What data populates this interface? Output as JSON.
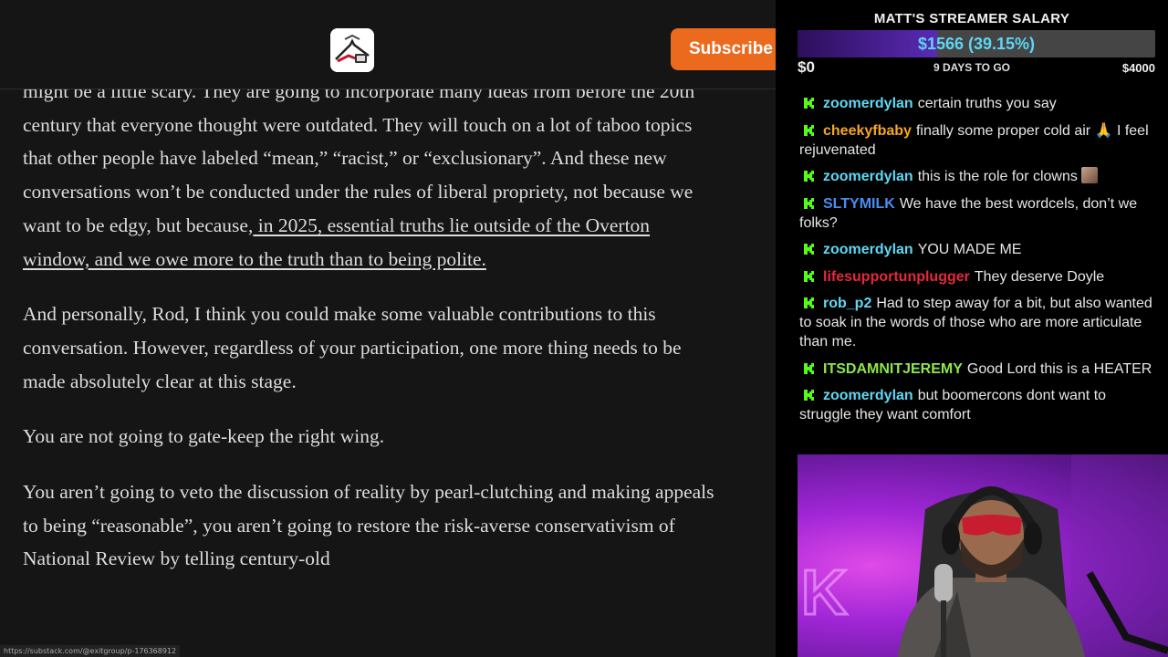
{
  "article": {
    "subscribe_label": "Subscribe",
    "paragraphs": {
      "p1": "might be a little scary. They are going to incorporate many ideas from before the 20th century that everyone thought were outdated. They will touch on a lot of taboo topics that other people have labeled “mean,” “racist,” or “exclusionary”. And these new conversations won’t be conducted under the rules of liberal propriety, not because we want to be edgy, but because,",
      "p1_link": " in 2025, essential truths lie outside of the Overton window, and we owe more to the truth than to being polite.",
      "p2": "And personally, Rod, I think you could make some valuable contributions to this conversation. However, regardless of your participation, one more thing needs to be made absolutely clear at this stage.",
      "p3": "You are not going to gate-keep the right wing.",
      "p4": "You aren’t going to veto the discussion of reality by pearl-clutching and making appeals to being “reasonable”, you aren’t going to restore the risk-averse conservativism of National Review by telling century-old"
    },
    "status_url": "https://substack.com/@exitgroup/p-176368912"
  },
  "goal": {
    "title": "MATT'S STREAMER SALARY",
    "current": "$1566 (39.15%)",
    "percent": 39.15,
    "min": "$0",
    "remaining": "9 DAYS TO GO",
    "max": "$4000"
  },
  "chat": [
    {
      "user": "zoomerdylan",
      "color": "#5fd8f4",
      "text": "certain truths you say"
    },
    {
      "user": "cheekyfbaby",
      "color": "#f5a623",
      "text": "finally some proper cold air 🙏 I feel rejuvenated"
    },
    {
      "user": "zoomerdylan",
      "color": "#5fd8f4",
      "text": "this is the role for clowns",
      "emote": true
    },
    {
      "user": "SLTYMILK",
      "color": "#4a8cf0",
      "text": "We have the best wordcels, don’t we folks?"
    },
    {
      "user": "zoomerdylan",
      "color": "#5fd8f4",
      "text": "YOU MADE ME"
    },
    {
      "user": "lifesupportunplugger",
      "color": "#e6283a",
      "text": "They deserve Doyle"
    },
    {
      "user": "rob_p2",
      "color": "#5fd8f4",
      "text": "Had to step away for a bit, but also wanted to soak in the words of those who are more articulate than me."
    },
    {
      "user": "ITSDAMNITJEREMY",
      "color": "#8de84a",
      "text": "Good Lord this is a HEATER"
    },
    {
      "user": "zoomerdylan",
      "color": "#5fd8f4",
      "text": "but boomercons dont want to struggle they want comfort"
    }
  ],
  "colors": {
    "kick_green": "#53fc18",
    "subscribe_orange": "#ec6a1e",
    "goal_fill": "#5a2ab4"
  },
  "icons": {
    "kick_badge": "kick-icon",
    "publication_logo": "substack-logo-icon"
  }
}
